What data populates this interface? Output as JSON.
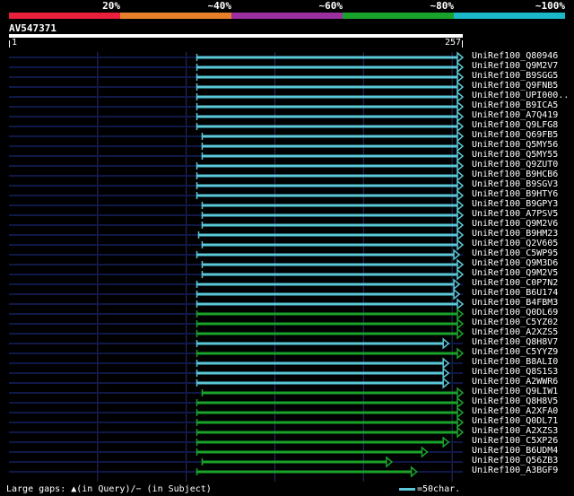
{
  "legend": {
    "colors": [
      "#e8203c",
      "#e87f2a",
      "#9b2fa0",
      "#1aa32a",
      "#1ab8c8"
    ],
    "labels": [
      "20%",
      "~40%",
      "~60%",
      "~80%",
      "~100%"
    ]
  },
  "query": {
    "id": "AV547371",
    "start": "1",
    "end": "257"
  },
  "palette": {
    "cyan": "#5ac8d8",
    "green": "#1aa32a",
    "background_line": "#101848",
    "grid": "#2a2f6a"
  },
  "hits": [
    {
      "name": "UniRef100_Q80946",
      "start": 107,
      "end": 257,
      "color": "cyan"
    },
    {
      "name": "UniRef100_Q9M2V7",
      "start": 107,
      "end": 257,
      "color": "cyan"
    },
    {
      "name": "UniRef100_B9SGG5",
      "start": 107,
      "end": 257,
      "color": "cyan"
    },
    {
      "name": "UniRef100_Q9FNB5",
      "start": 107,
      "end": 257,
      "color": "cyan"
    },
    {
      "name": "UniRef100_UPI000..",
      "start": 107,
      "end": 257,
      "color": "cyan"
    },
    {
      "name": "UniRef100_B9ICA5",
      "start": 107,
      "end": 257,
      "color": "cyan"
    },
    {
      "name": "UniRef100_A7Q419",
      "start": 107,
      "end": 257,
      "color": "cyan"
    },
    {
      "name": "UniRef100_Q9LFG8",
      "start": 107,
      "end": 257,
      "color": "cyan"
    },
    {
      "name": "UniRef100_Q69FB5",
      "start": 110,
      "end": 257,
      "color": "cyan"
    },
    {
      "name": "UniRef100_Q5MY56",
      "start": 110,
      "end": 257,
      "color": "cyan"
    },
    {
      "name": "UniRef100_Q5MY55",
      "start": 110,
      "end": 257,
      "color": "cyan"
    },
    {
      "name": "UniRef100_Q9ZUT0",
      "start": 107,
      "end": 257,
      "color": "cyan"
    },
    {
      "name": "UniRef100_B9HCB6",
      "start": 107,
      "end": 257,
      "color": "cyan"
    },
    {
      "name": "UniRef100_B9SGV3",
      "start": 107,
      "end": 257,
      "color": "cyan"
    },
    {
      "name": "UniRef100_B9HTY6",
      "start": 107,
      "end": 257,
      "color": "cyan"
    },
    {
      "name": "UniRef100_B9GPY3",
      "start": 110,
      "end": 257,
      "color": "cyan"
    },
    {
      "name": "UniRef100_A7PSV5",
      "start": 110,
      "end": 257,
      "color": "cyan"
    },
    {
      "name": "UniRef100_Q9M2V6",
      "start": 110,
      "end": 257,
      "color": "cyan"
    },
    {
      "name": "UniRef100_B9HM23",
      "start": 108,
      "end": 257,
      "color": "cyan"
    },
    {
      "name": "UniRef100_Q2V605",
      "start": 110,
      "end": 257,
      "color": "cyan"
    },
    {
      "name": "UniRef100_C5WP95",
      "start": 107,
      "end": 255,
      "color": "cyan"
    },
    {
      "name": "UniRef100_Q9M3D6",
      "start": 110,
      "end": 257,
      "color": "cyan"
    },
    {
      "name": "UniRef100_Q9M2V5",
      "start": 110,
      "end": 257,
      "color": "cyan"
    },
    {
      "name": "UniRef100_C0P7N2",
      "start": 107,
      "end": 255,
      "color": "cyan"
    },
    {
      "name": "UniRef100_B6U174",
      "start": 107,
      "end": 255,
      "color": "cyan"
    },
    {
      "name": "UniRef100_B4FBM3",
      "start": 107,
      "end": 257,
      "color": "cyan"
    },
    {
      "name": "UniRef100_Q0DL69",
      "start": 107,
      "end": 257,
      "color": "green"
    },
    {
      "name": "UniRef100_C5YZ02",
      "start": 107,
      "end": 257,
      "color": "green"
    },
    {
      "name": "UniRef100_A2XZS5",
      "start": 107,
      "end": 257,
      "color": "green"
    },
    {
      "name": "UniRef100_Q8H8V7",
      "start": 107,
      "end": 249,
      "color": "cyan"
    },
    {
      "name": "UniRef100_C5YYZ9",
      "start": 107,
      "end": 257,
      "color": "green"
    },
    {
      "name": "UniRef100_B8ALI0",
      "start": 107,
      "end": 249,
      "color": "cyan"
    },
    {
      "name": "UniRef100_Q8S1S3",
      "start": 107,
      "end": 249,
      "color": "cyan"
    },
    {
      "name": "UniRef100_A2WWR6",
      "start": 107,
      "end": 249,
      "color": "cyan"
    },
    {
      "name": "UniRef100_Q9LIW1",
      "start": 110,
      "end": 257,
      "color": "green"
    },
    {
      "name": "UniRef100_Q8H8V5",
      "start": 107,
      "end": 257,
      "color": "green"
    },
    {
      "name": "UniRef100_A2XFA0",
      "start": 107,
      "end": 257,
      "color": "green"
    },
    {
      "name": "UniRef100_Q0DL71",
      "start": 107,
      "end": 257,
      "color": "green"
    },
    {
      "name": "UniRef100_A2XZS3",
      "start": 107,
      "end": 257,
      "color": "green"
    },
    {
      "name": "UniRef100_C5XP26",
      "start": 107,
      "end": 249,
      "color": "green"
    },
    {
      "name": "UniRef100_B6UDM4",
      "start": 107,
      "end": 237,
      "color": "green"
    },
    {
      "name": "UniRef100_Q56ZB3",
      "start": 110,
      "end": 217,
      "color": "green"
    },
    {
      "name": "UniRef100_A3BGF9",
      "start": 107,
      "end": 231,
      "color": "green"
    }
  ],
  "footer": {
    "gaps_text": "Large gaps: ▲(in Query)/− (in Subject)",
    "scale_text": "=50char."
  }
}
